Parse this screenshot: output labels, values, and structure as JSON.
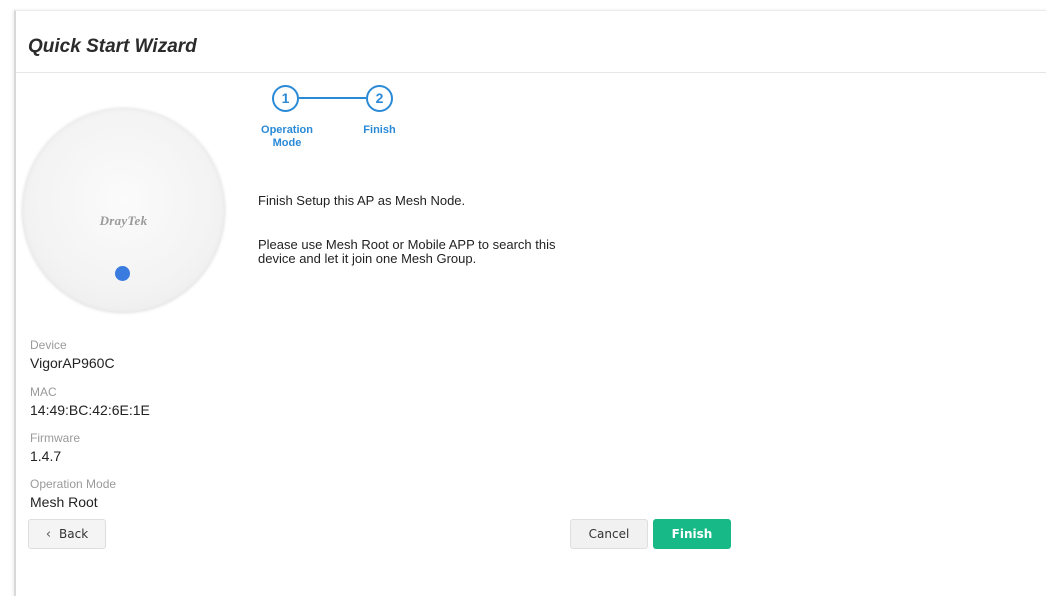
{
  "wizard": {
    "title": "Quick Start Wizard",
    "steps": [
      {
        "number": "1",
        "label_line1": "Operation",
        "label_line2": "Mode"
      },
      {
        "number": "2",
        "label_line1": "Finish",
        "label_line2": ""
      }
    ],
    "message1": "Finish Setup this AP as Mesh Node.",
    "message2_line1": "Please use Mesh Root or Mobile APP to search this",
    "message2_line2": "device and let it join one Mesh Group."
  },
  "device_image": {
    "logo_text": "DrayTek",
    "led_color": "#3a7be0"
  },
  "device_info": {
    "device_label": "Device",
    "device_value": "VigorAP960C",
    "mac_label": "MAC",
    "mac_value": "14:49:BC:42:6E:1E",
    "firmware_label": "Firmware",
    "firmware_value": "1.4.7",
    "mode_label": "Operation Mode",
    "mode_value": "Mesh Root"
  },
  "buttons": {
    "back_icon": "chevron-left-icon",
    "back": "Back",
    "cancel": "Cancel",
    "finish": "Finish"
  },
  "colors": {
    "accent": "#2b8ad6",
    "finish_button": "#17b987"
  }
}
